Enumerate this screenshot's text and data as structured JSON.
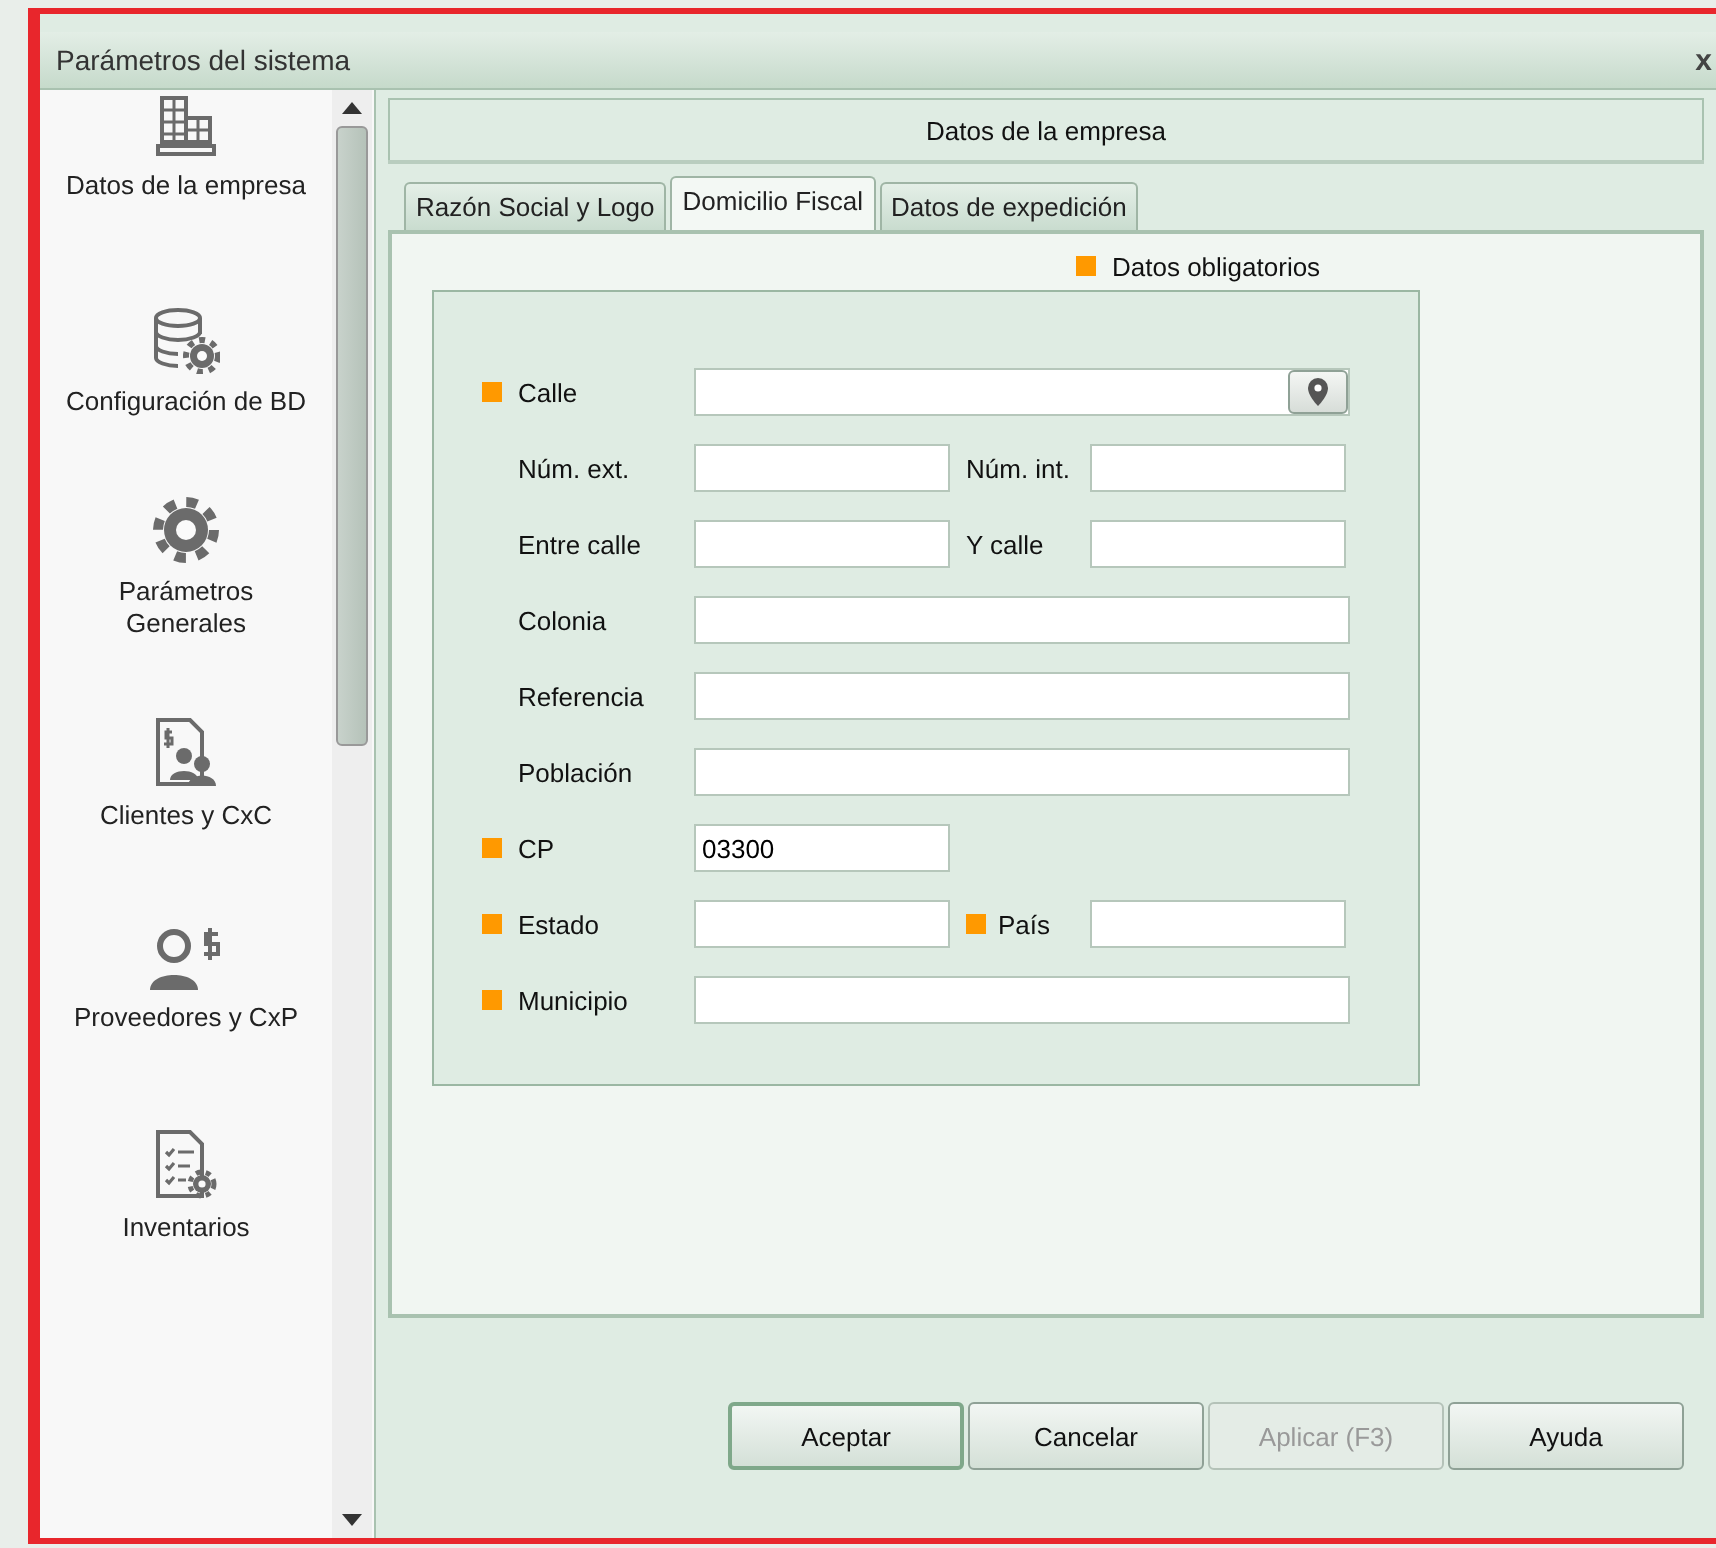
{
  "window": {
    "title": "Parámetros del sistema",
    "close": "x"
  },
  "sidebar": {
    "items": [
      {
        "kind": "building",
        "label": "Datos de la empresa"
      },
      {
        "kind": "database",
        "label": "Configuración de BD"
      },
      {
        "kind": "gear",
        "label": "Parámetros Generales"
      },
      {
        "kind": "clients",
        "label": "Clientes y CxC"
      },
      {
        "kind": "suppliers",
        "label": "Proveedores y CxP"
      },
      {
        "kind": "inventory",
        "label": "Inventarios"
      }
    ]
  },
  "panel": {
    "title": "Datos de la empresa",
    "tabs": [
      {
        "label": "Razón Social y Logo",
        "selected": false
      },
      {
        "label": "Domicilio Fiscal",
        "selected": true
      },
      {
        "label": "Datos de expedición",
        "selected": false
      }
    ],
    "legend": {
      "label": "Datos obligatorios",
      "color": "#ff9900"
    },
    "rows": [
      {
        "kind": "locate",
        "fields": [
          {
            "label": "Calle",
            "required": true
          }
        ]
      },
      {
        "kind": "pair",
        "fields": [
          {
            "label": "Núm. ext.",
            "required": false
          },
          {
            "label": "Núm. int.",
            "required": false
          }
        ]
      },
      {
        "kind": "pair",
        "fields": [
          {
            "label": "Entre calle",
            "required": false
          },
          {
            "label": "Y calle",
            "required": false
          }
        ]
      },
      {
        "kind": "wide",
        "fields": [
          {
            "label": "Colonia",
            "required": false
          }
        ]
      },
      {
        "kind": "wide",
        "fields": [
          {
            "label": "Referencia",
            "required": false
          }
        ]
      },
      {
        "kind": "wide",
        "fields": [
          {
            "label": "Población",
            "required": false
          }
        ]
      },
      {
        "kind": "short",
        "fields": [
          {
            "label": "CP",
            "required": true,
            "value": "03300"
          }
        ]
      },
      {
        "kind": "pair",
        "fields": [
          {
            "label": "Estado",
            "required": true
          },
          {
            "label": "País",
            "required": true
          }
        ]
      },
      {
        "kind": "wide",
        "fields": [
          {
            "label": "Municipio",
            "required": true
          }
        ]
      }
    ]
  },
  "buttons": [
    {
      "label": "Aceptar",
      "default": true,
      "disabled": false
    },
    {
      "label": "Cancelar",
      "default": false,
      "disabled": false
    },
    {
      "label": "Aplicar (F3)",
      "default": false,
      "disabled": true
    },
    {
      "label": "Ayuda",
      "default": false,
      "disabled": false
    }
  ]
}
